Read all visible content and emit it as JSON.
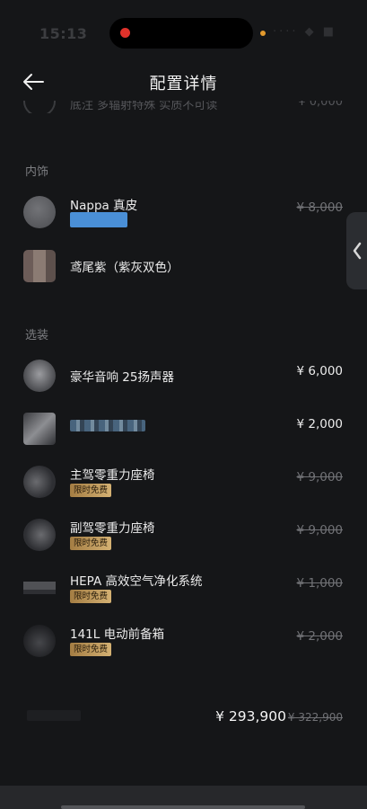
{
  "status_bar": {
    "time": "15:13",
    "icons": "···· ◆ ■"
  },
  "header": {
    "title": "配置详情"
  },
  "faded_top_row": {
    "text": "底注 多辐射特殊 实质不可读",
    "price": "¥ 0,000"
  },
  "sections": {
    "interior": "内饰",
    "options": "选装"
  },
  "interior_items": [
    {
      "name": "Nappa 真皮",
      "price": "¥ 8,000",
      "price_struck": true,
      "has_blue_tag": true
    },
    {
      "name": "鸢尾紫（紫灰双色）",
      "price": ""
    }
  ],
  "option_items": [
    {
      "name": "豪华音响 25扬声器",
      "price": "¥ 6,000",
      "badge": ""
    },
    {
      "name": "",
      "price": "¥ 2,000",
      "badge": "",
      "name_obscured": true
    },
    {
      "name": "主驾零重力座椅",
      "price": "¥ 9,000",
      "badge": "限时免费"
    },
    {
      "name": "副驾零重力座椅",
      "price": "¥ 9,000",
      "badge": "限时免费"
    },
    {
      "name": "HEPA 高效空气净化系统",
      "price": "¥ 1,000",
      "badge": "限时免费"
    },
    {
      "name": "141L 电动前备箱",
      "price": "¥ 2,000",
      "badge": "限时免费"
    }
  ],
  "total": {
    "price": "¥ 293,900",
    "original_price": "¥ 322,900"
  },
  "colors": {
    "background": "#151618",
    "badge_gold": "#c9a466",
    "tag_blue": "#4a8fd6",
    "strike_gray": "#707175"
  },
  "icons": {
    "back": "arrow-left-icon",
    "side_tab": "chevron-left-icon"
  }
}
